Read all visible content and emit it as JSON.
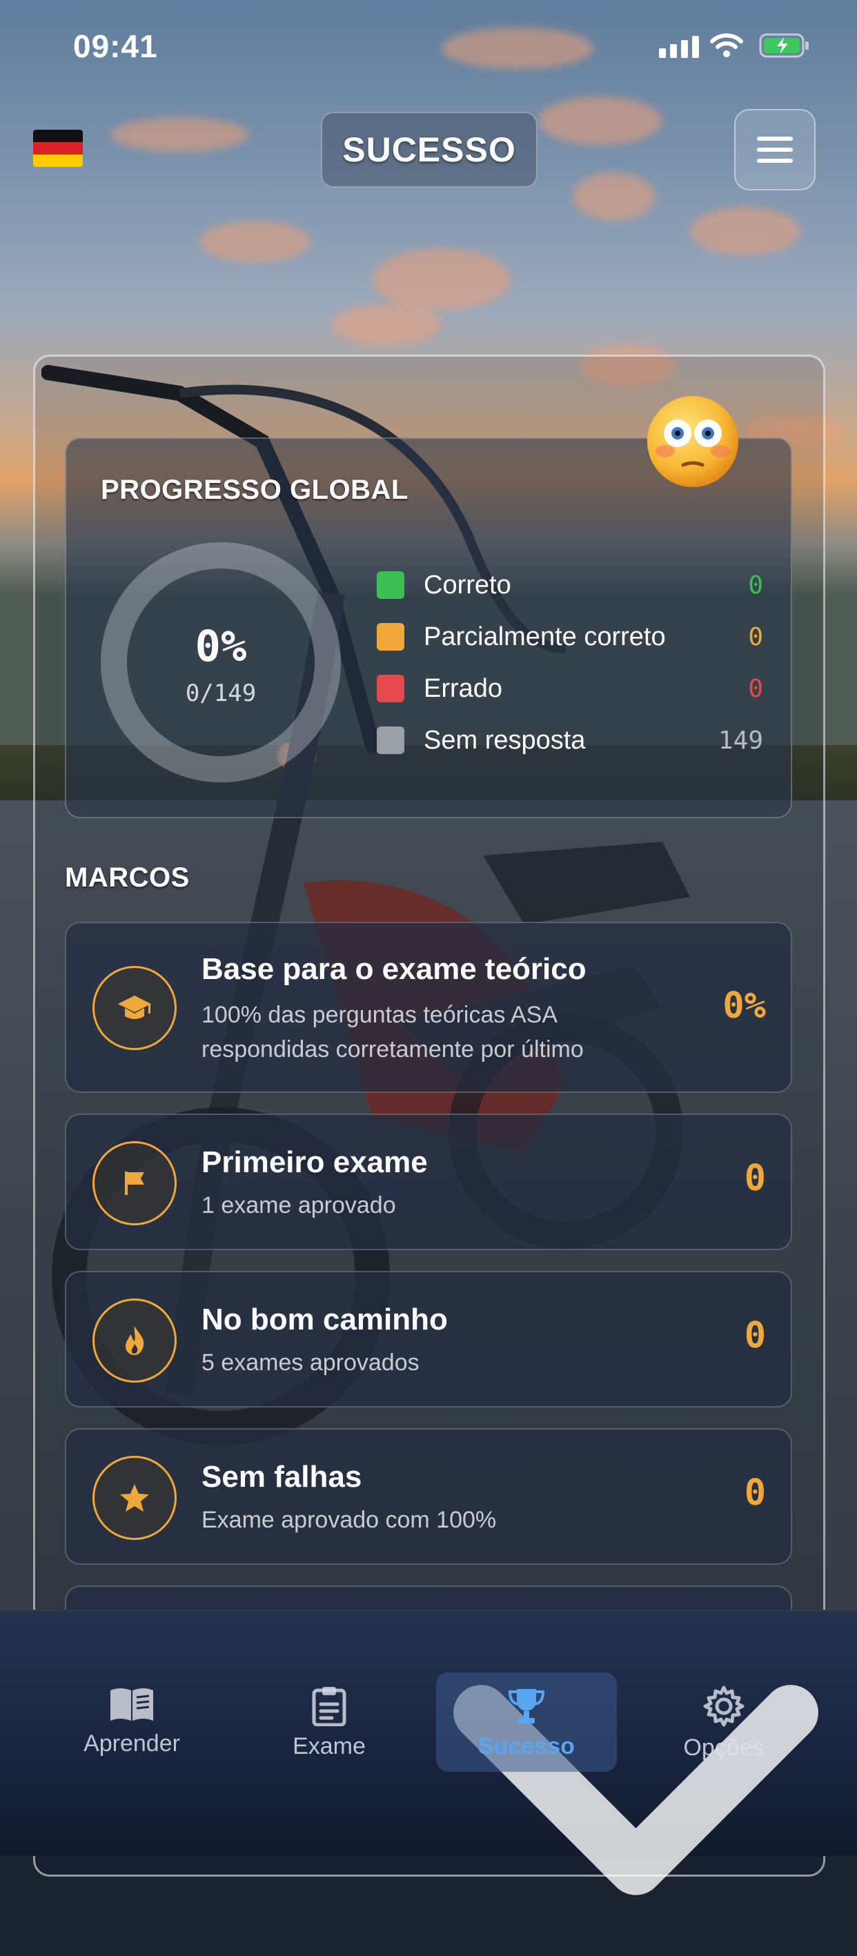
{
  "status_bar": {
    "time": "09:41"
  },
  "header": {
    "title": "SUCESSO",
    "flag": "german-flag",
    "menu_icon": "hamburger-menu-icon"
  },
  "progress": {
    "title": "PROGRESSO GLOBAL",
    "percent_label": "0%",
    "count_label": "0/149",
    "percent_value": 0,
    "legend": [
      {
        "label": "Correto",
        "value": "0",
        "color": "#3cbf55"
      },
      {
        "label": "Parcialmente correto",
        "value": "0",
        "color": "#f0a83a"
      },
      {
        "label": "Errado",
        "value": "0",
        "color": "#e5484d"
      },
      {
        "label": "Sem resposta",
        "value": "149",
        "color": "#9aa0a6"
      }
    ]
  },
  "milestones": {
    "title": "MARCOS",
    "items": [
      {
        "title": "Base para o exame teórico",
        "desc": "100% das perguntas teóricas ASA respondidas corretamente por último",
        "value": "0%",
        "icon": "graduation-cap-icon"
      },
      {
        "title": "Primeiro exame",
        "desc": "1 exame aprovado",
        "value": "0",
        "icon": "flag-icon"
      },
      {
        "title": "No bom caminho",
        "desc": "5 exames aprovados",
        "value": "0",
        "icon": "flame-icon"
      },
      {
        "title": "Sem falhas",
        "desc": "Exame aprovado com 100%",
        "value": "0",
        "icon": "star-icon"
      }
    ]
  },
  "nav": {
    "tabs": [
      {
        "label": "Aprender",
        "icon": "book-icon"
      },
      {
        "label": "Exame",
        "icon": "clipboard-icon"
      },
      {
        "label": "Sucesso",
        "icon": "trophy-icon",
        "active": true
      },
      {
        "label": "Opções",
        "icon": "gear-icon"
      }
    ]
  },
  "colors": {
    "accent": "#f0a83a",
    "active_tab": "#58a6f2"
  }
}
